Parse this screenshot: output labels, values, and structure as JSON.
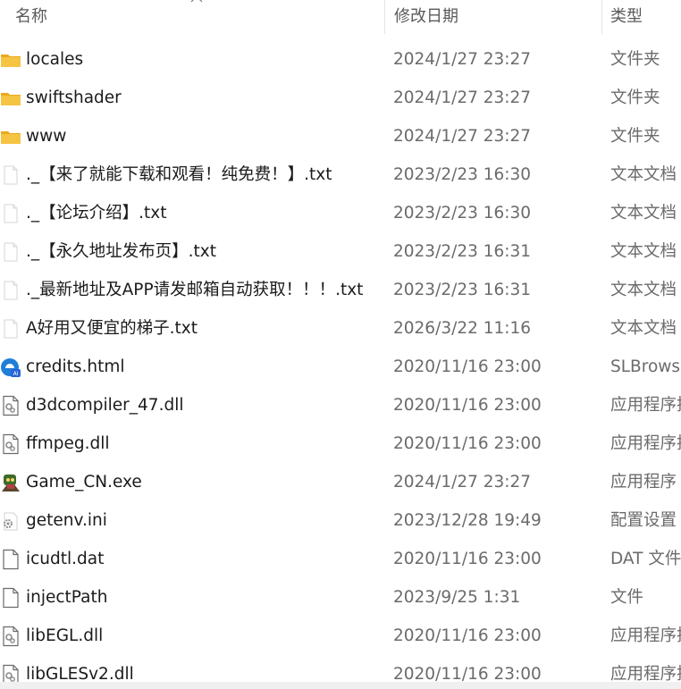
{
  "columns": {
    "name": "名称",
    "date": "修改日期",
    "type": "类型"
  },
  "files": [
    {
      "name": "locales",
      "date": "2024/1/27 23:27",
      "type": "文件夹",
      "icon": "folder-icon"
    },
    {
      "name": "swiftshader",
      "date": "2024/1/27 23:27",
      "type": "文件夹",
      "icon": "folder-icon"
    },
    {
      "name": "www",
      "date": "2024/1/27 23:27",
      "type": "文件夹",
      "icon": "folder-icon"
    },
    {
      "name": "._【来了就能下载和观看！纯免费！】.txt",
      "date": "2023/2/23 16:30",
      "type": "文本文档",
      "icon": "text-file-icon"
    },
    {
      "name": "._【论坛介绍】.txt",
      "date": "2023/2/23 16:30",
      "type": "文本文档",
      "icon": "text-file-icon"
    },
    {
      "name": "._【永久地址发布页】.txt",
      "date": "2023/2/23 16:31",
      "type": "文本文档",
      "icon": "text-file-icon"
    },
    {
      "name": "._最新地址及APP请发邮箱自动获取！！！.txt",
      "date": "2023/2/23 16:31",
      "type": "文本文档",
      "icon": "text-file-icon"
    },
    {
      "name": "A好用又便宜的梯子.txt",
      "date": "2026/3/22 11:16",
      "type": "文本文档",
      "icon": "text-file-icon"
    },
    {
      "name": "credits.html",
      "date": "2020/11/16 23:00",
      "type": "SLBrowser",
      "icon": "browser-icon"
    },
    {
      "name": "d3dcompiler_47.dll",
      "date": "2020/11/16 23:00",
      "type": "应用程序扩",
      "icon": "dll-file-icon"
    },
    {
      "name": "ffmpeg.dll",
      "date": "2020/11/16 23:00",
      "type": "应用程序扩",
      "icon": "dll-file-icon"
    },
    {
      "name": "Game_CN.exe",
      "date": "2024/1/27 23:27",
      "type": "应用程序",
      "icon": "game-exe-icon"
    },
    {
      "name": "getenv.ini",
      "date": "2023/12/28 19:49",
      "type": "配置设置",
      "icon": "settings-file-icon"
    },
    {
      "name": "icudtl.dat",
      "date": "2020/11/16 23:00",
      "type": "DAT 文件",
      "icon": "blank-file-icon"
    },
    {
      "name": "injectPath",
      "date": "2023/9/25 1:31",
      "type": "文件",
      "icon": "blank-file-icon"
    },
    {
      "name": "libEGL.dll",
      "date": "2020/11/16 23:00",
      "type": "应用程序扩",
      "icon": "dll-file-icon"
    },
    {
      "name": "libGLESv2.dll",
      "date": "2020/11/16 23:00",
      "type": "应用程序扩",
      "icon": "dll-file-icon"
    }
  ],
  "colors": {
    "folder": "#f6c443",
    "folder_dark": "#e9a91c",
    "text_primary": "#1b1b1b",
    "text_secondary": "#6b6b6b",
    "header_text": "#5a5a5a"
  }
}
